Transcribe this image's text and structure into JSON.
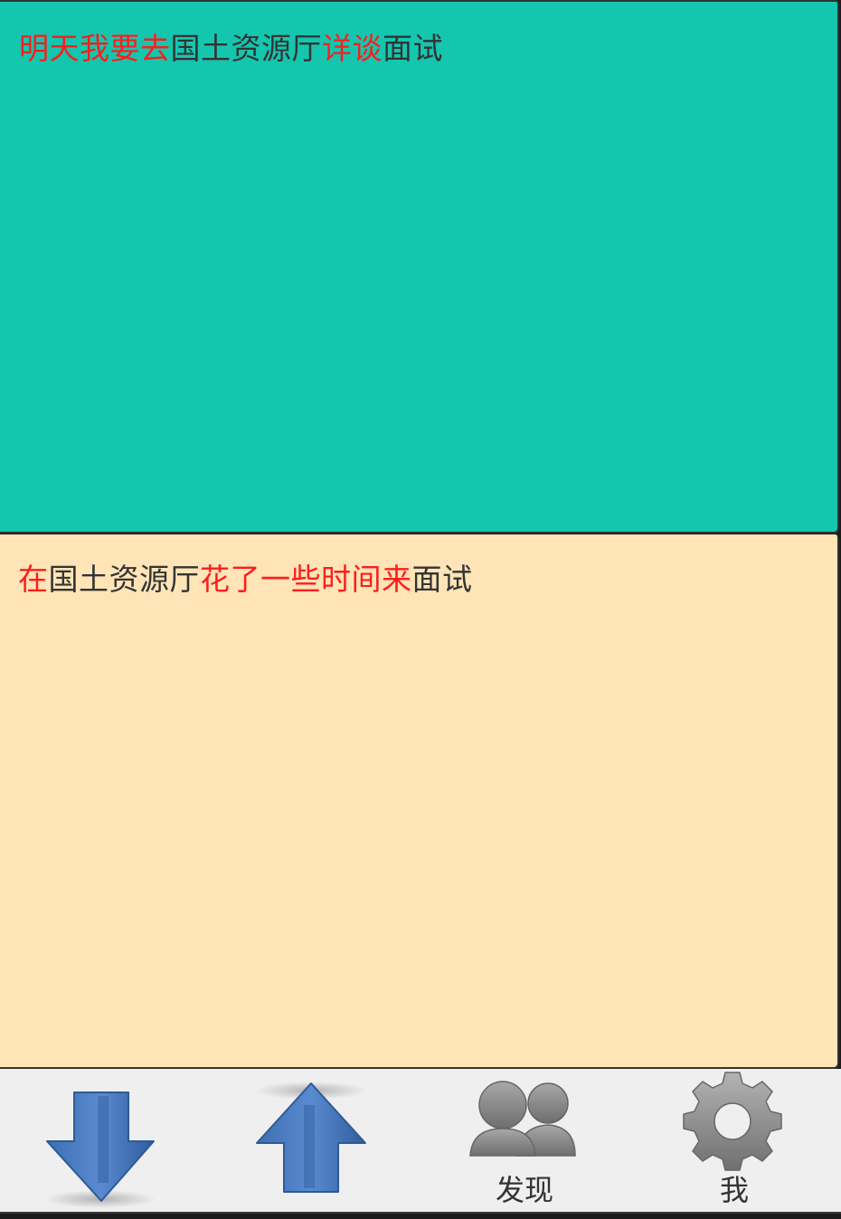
{
  "messages": [
    {
      "segments": [
        {
          "text": "明天我要去",
          "highlight": true
        },
        {
          "text": "国土资源厅",
          "highlight": false
        },
        {
          "text": "详谈",
          "highlight": true
        },
        {
          "text": "面试",
          "highlight": false
        }
      ]
    },
    {
      "segments": [
        {
          "text": "在",
          "highlight": true
        },
        {
          "text": "国土资源厅",
          "highlight": false
        },
        {
          "text": "花了一些时间来",
          "highlight": true
        },
        {
          "text": "面试",
          "highlight": false
        }
      ]
    }
  ],
  "tabs": [
    {
      "icon": "arrow-down-icon",
      "label": ""
    },
    {
      "icon": "arrow-up-icon",
      "label": ""
    },
    {
      "icon": "people-icon",
      "label": "发现"
    },
    {
      "icon": "gear-icon",
      "label": "我"
    }
  ],
  "colors": {
    "top_panel": "#14c6ae",
    "bottom_panel": "#fee4b6",
    "highlight_text": "#fd1d1d",
    "normal_text": "#333333",
    "tabbar": "#efefef"
  }
}
